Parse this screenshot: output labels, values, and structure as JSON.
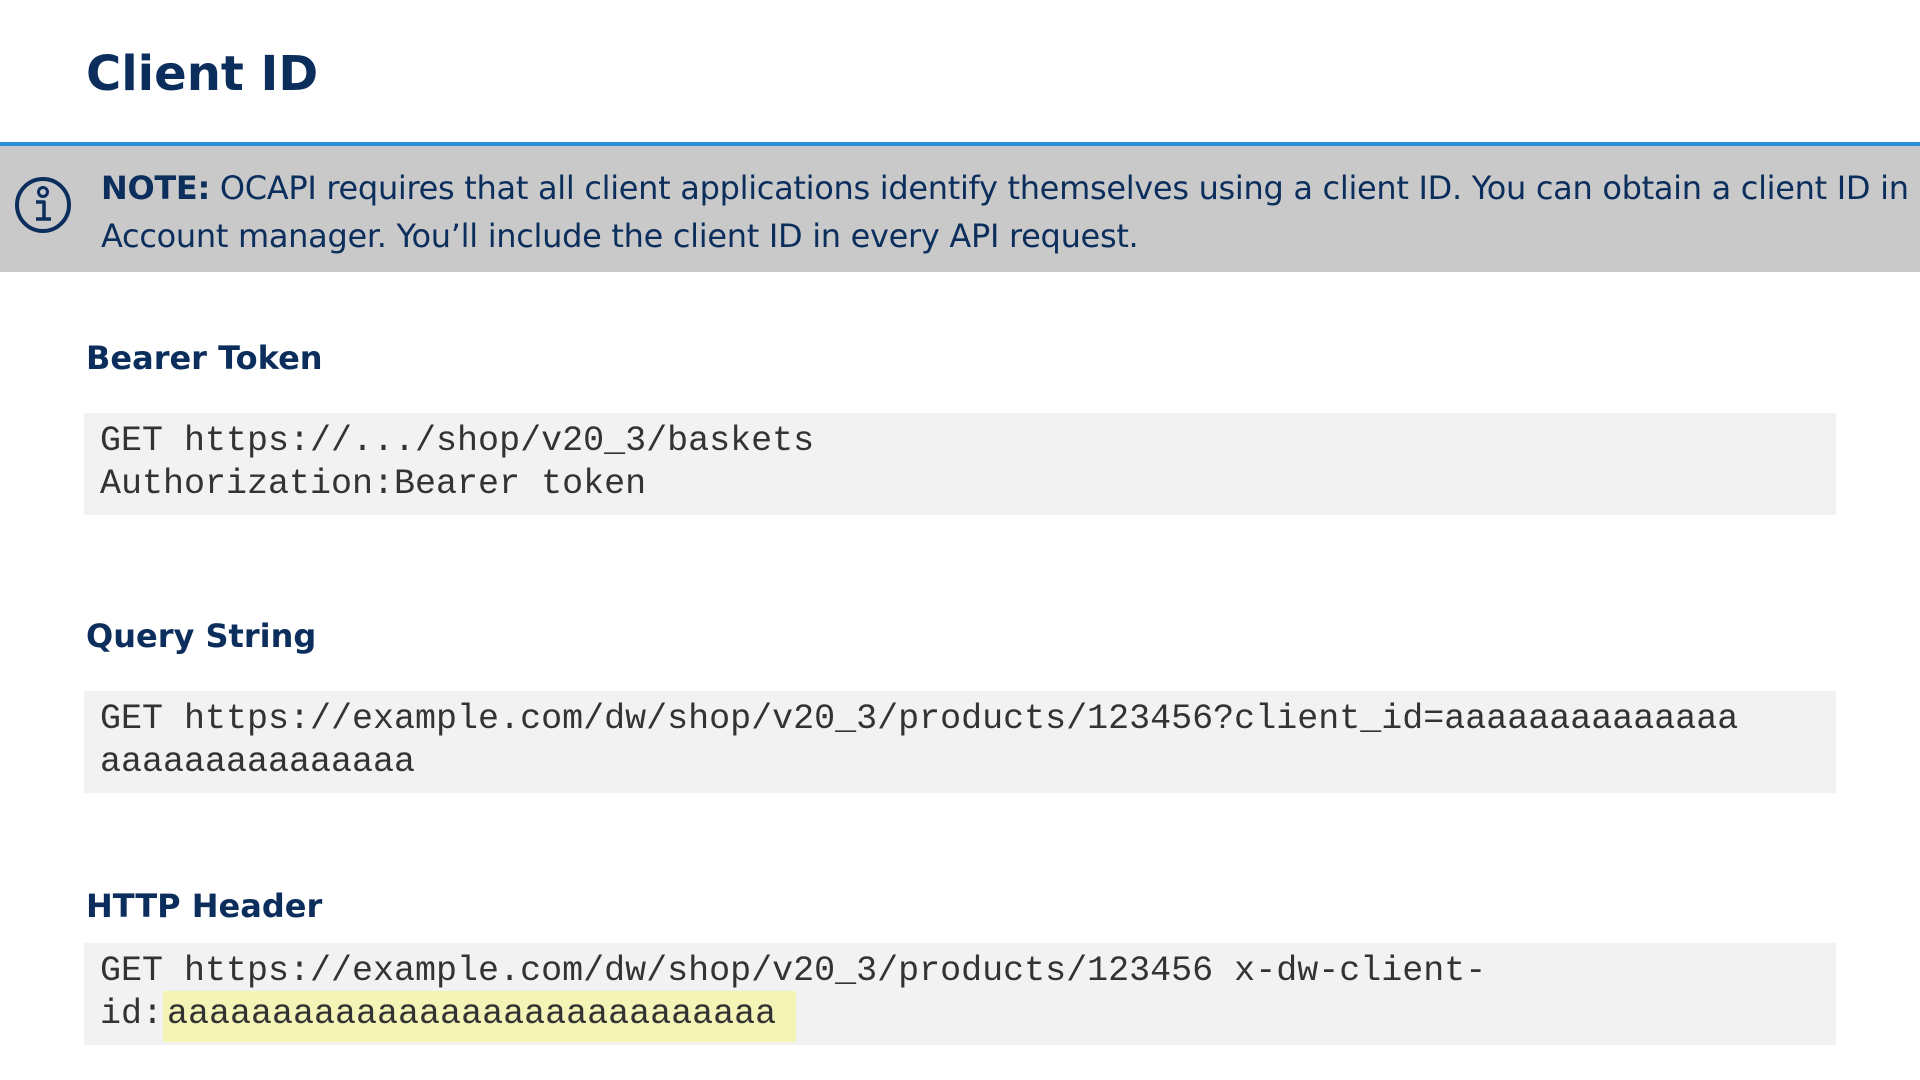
{
  "page": {
    "title": "Client ID"
  },
  "note": {
    "icon": "info-icon",
    "label": "NOTE:",
    "text": " OCAPI requires that all client applications identify themselves using a client ID. You can obtain a client ID in Account manager. You’ll include the client ID in every API request.",
    "colors": {
      "background": "#c9c9c9",
      "accent_border": "#2b8fd6",
      "text": "#0b2e5c"
    }
  },
  "sections": {
    "bearer_token": {
      "heading": "Bearer Token",
      "code_line_1": "GET https://.../shop/v20_3/baskets",
      "code_line_2": "Authorization:Bearer token"
    },
    "query_string": {
      "heading": "Query String",
      "code_line_1": "GET https://example.com/dw/shop/v20_3/products/123456?client_id=aaaaaaaaaaaaaa",
      "code_line_2": "aaaaaaaaaaaaaaa"
    },
    "http_header": {
      "heading": "HTTP Header",
      "code_line_1": "GET https://example.com/dw/shop/v20_3/products/123456 x-dw-client-",
      "code_line_2_prefix": "id:",
      "code_line_2_highlight": "aaaaaaaaaaaaaaaaaaaaaaaaaaaaa"
    }
  },
  "colors": {
    "heading": "#0b2e5c",
    "code_background": "#f2f2f2",
    "code_text": "#333333",
    "highlight": "#f3f4b6"
  }
}
